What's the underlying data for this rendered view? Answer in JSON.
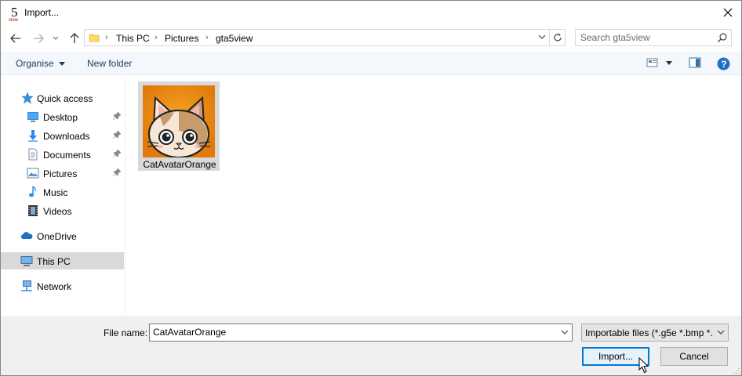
{
  "window": {
    "title": "Import...",
    "app_icon_numeral": "5",
    "app_icon_caption": "view"
  },
  "nav": {
    "breadcrumbs": [
      "This PC",
      "Pictures",
      "gta5view"
    ],
    "search_placeholder": "Search gta5view"
  },
  "toolbar": {
    "organise_label": "Organise",
    "new_folder_label": "New folder"
  },
  "sidebar": {
    "items": [
      {
        "label": "Quick access"
      },
      {
        "label": "Desktop"
      },
      {
        "label": "Downloads"
      },
      {
        "label": "Documents"
      },
      {
        "label": "Pictures"
      },
      {
        "label": "Music"
      },
      {
        "label": "Videos"
      },
      {
        "label": "OneDrive"
      },
      {
        "label": "This PC"
      },
      {
        "label": "Network"
      }
    ],
    "selected": "This PC"
  },
  "files": [
    {
      "name": "CatAvatarOrange",
      "icon": "cat-avatar-thumbnail"
    }
  ],
  "footer": {
    "file_name_label": "File name:",
    "file_name_value": "CatAvatarOrange",
    "file_type_value": "Importable files (*.g5e *.bmp *.",
    "import_label": "Import...",
    "cancel_label": "Cancel"
  },
  "colors": {
    "accent": "#0078d7",
    "selection": "#d9d9d9",
    "command_bar": "#f4f7fc",
    "footer_bg": "#f0f0f0",
    "help_blue": "#1f6fc5"
  }
}
